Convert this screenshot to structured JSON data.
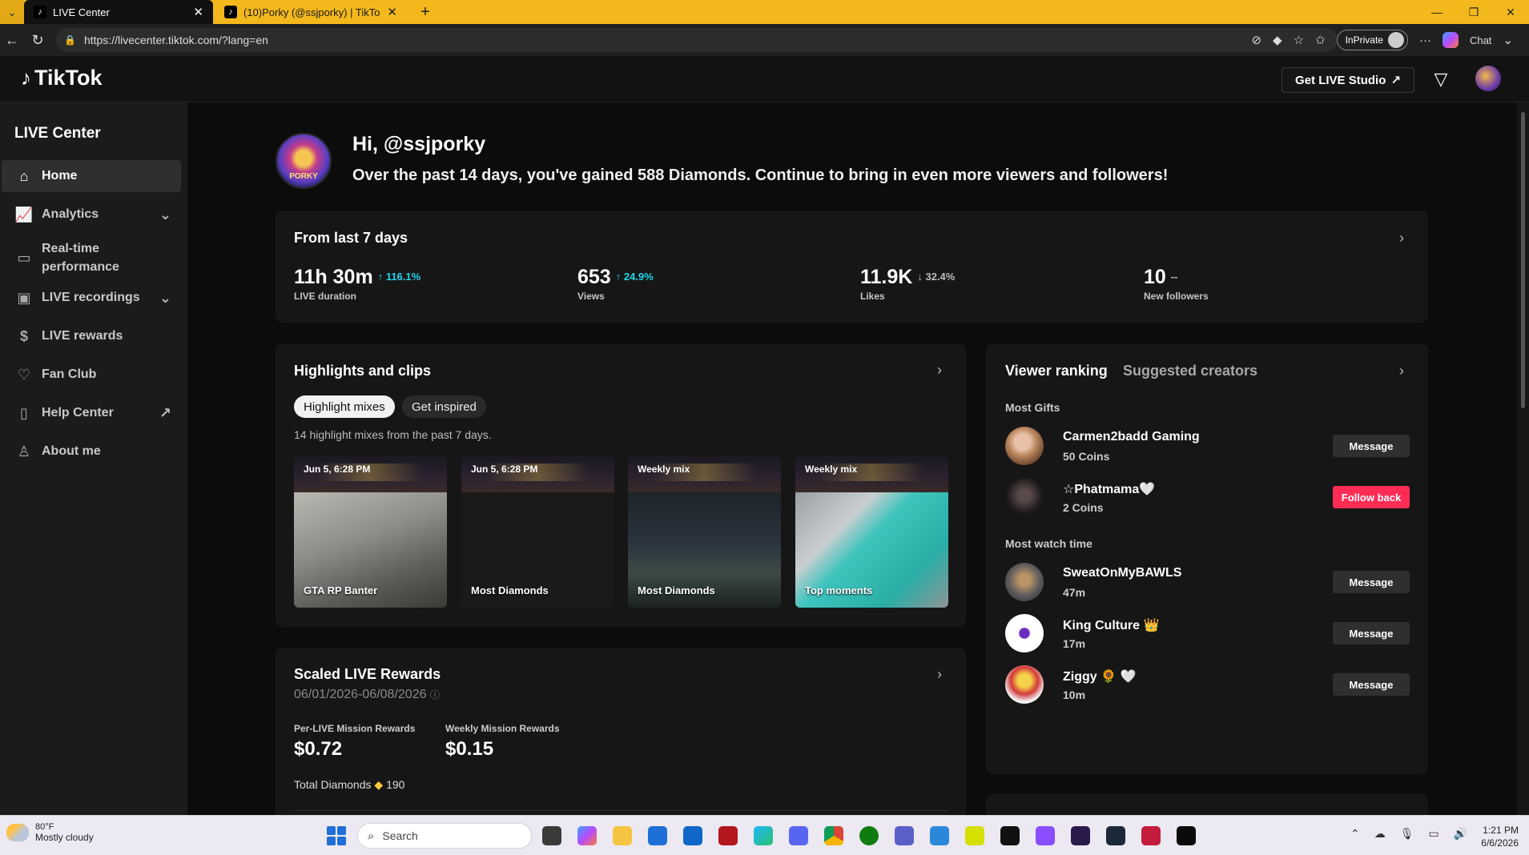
{
  "browser": {
    "tabs": [
      {
        "title": "LIVE Center"
      },
      {
        "title": "(10)Porky (@ssjporky) | TikTok"
      }
    ],
    "url": "https://livecenter.tiktok.com/?lang=en",
    "inprivate_label": "InPrivate",
    "chat_label": "Chat"
  },
  "header": {
    "logo_text": "TikTok",
    "studio_button": "Get LIVE Studio"
  },
  "sidebar": {
    "title": "LIVE Center",
    "items": [
      {
        "label": "Home",
        "icon": "home-icon"
      },
      {
        "label": "Analytics",
        "icon": "analytics-icon"
      },
      {
        "label": "Real-time performance",
        "icon": "monitor-icon"
      },
      {
        "label": "LIVE recordings",
        "icon": "recording-icon"
      },
      {
        "label": "LIVE rewards",
        "icon": "dollar-icon"
      },
      {
        "label": "Fan Club",
        "icon": "heart-icon"
      },
      {
        "label": "Help Center",
        "icon": "book-icon"
      },
      {
        "label": "About me",
        "icon": "user-icon"
      }
    ]
  },
  "greeting": {
    "title": "Hi, @ssjporky",
    "subtitle": "Over the past 14 days, you've gained 588 Diamonds. Continue to bring in even more viewers and followers!",
    "avatar_text": "PORKY"
  },
  "last7": {
    "title": "From last 7 days",
    "stats": [
      {
        "value": "11h 30m",
        "change": "116.1%",
        "direction": "up",
        "label": "LIVE duration"
      },
      {
        "value": "653",
        "change": "24.9%",
        "direction": "up",
        "label": "Views"
      },
      {
        "value": "11.9K",
        "change": "32.4%",
        "direction": "down",
        "label": "Likes"
      },
      {
        "value": "10",
        "change": "--",
        "direction": "none",
        "label": "New followers"
      }
    ]
  },
  "highlights": {
    "title": "Highlights and clips",
    "pills": [
      "Highlight mixes",
      "Get inspired"
    ],
    "description": "14 highlight mixes from the past 7 days.",
    "clips": [
      {
        "date": "Jun 5, 6:28 PM",
        "caption": "GTA RP Banter"
      },
      {
        "date": "Jun 5, 6:28 PM",
        "caption": "Most Diamonds"
      },
      {
        "date": "Weekly mix",
        "caption": "Most Diamonds"
      },
      {
        "date": "Weekly mix",
        "caption": "Top moments"
      }
    ]
  },
  "rewards": {
    "title": "Scaled LIVE Rewards",
    "date_range": "06/01/2026-06/08/2026",
    "per_live_label": "Per-LIVE Mission Rewards",
    "per_live_value": "$0.72",
    "weekly_label": "Weekly Mission Rewards",
    "weekly_value": "$0.15",
    "total_label": "Total Diamonds",
    "total_value": "190"
  },
  "ranking": {
    "tab_active": "Viewer ranking",
    "tab_inactive": "Suggested creators",
    "most_gifts_label": "Most Gifts",
    "most_watch_label": "Most watch time",
    "gifts": [
      {
        "name": "Carmen2badd Gaming",
        "sub": "50 Coins",
        "button": "Message"
      },
      {
        "name": "☆Phatmama🤍",
        "sub": "2 Coins",
        "button": "Follow back"
      }
    ],
    "watch": [
      {
        "name": "SweatOnMyBAWLS",
        "sub": "47m",
        "button": "Message"
      },
      {
        "name": "King Culture 👑",
        "sub": "17m",
        "button": "Message"
      },
      {
        "name": "Ziggy 🌻 🤍",
        "sub": "10m",
        "button": "Message"
      }
    ]
  },
  "taskbar": {
    "temperature": "80°F",
    "weather": "Mostly cloudy",
    "search_placeholder": "Search",
    "time": "1:21 PM",
    "date": "6/6/2026"
  },
  "colors": {
    "accent_up": "#20d5ec",
    "follow_button": "#fe2c55",
    "browser_frame": "#f3b81c"
  }
}
